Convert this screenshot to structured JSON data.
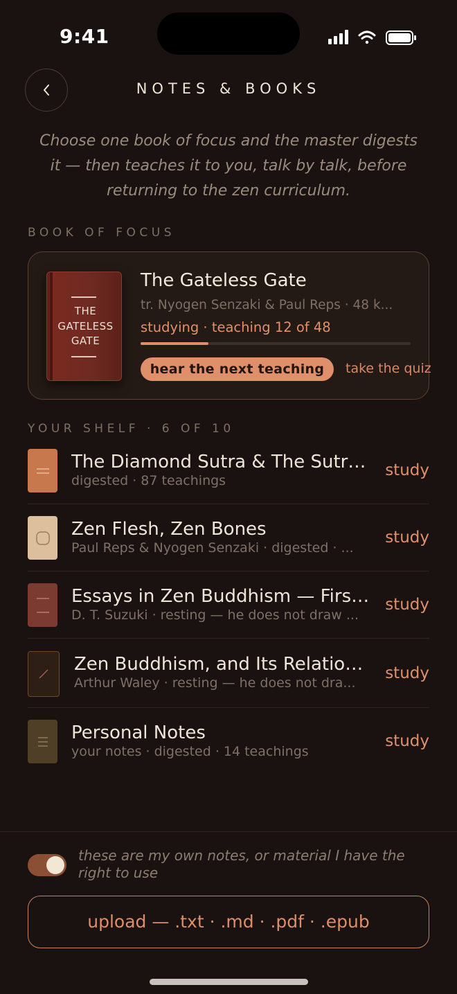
{
  "status_bar": {
    "time": "9:41",
    "icons": [
      "signal-icon",
      "wifi-icon",
      "battery-icon"
    ]
  },
  "header": {
    "back_icon": "chevron-left-icon",
    "title": "NOTES & BOOKS"
  },
  "intro": "Choose one book of focus and the master digests it — then teaches it to you, talk by talk, before returning to the zen curriculum.",
  "focus_section": {
    "label": "BOOK OF FOCUS",
    "book": {
      "cover_text": "THE GATELESS GATE",
      "title": "The Gateless Gate",
      "author": "tr. Nyogen Senzaki & Paul Reps · 48 k...",
      "status": "studying · teaching 12 of 48",
      "progress": 0.25,
      "primary_action": "hear the next teaching",
      "secondary_action": "take the quiz"
    }
  },
  "shelf": {
    "label": "YOUR SHELF · 6 OF 10",
    "items": [
      {
        "title": "The Diamond Sutra & The Sutra...",
        "meta": "digested · 87 teachings",
        "action": "study",
        "cover_color": "#c7794d",
        "cover_icon": "lines-icon"
      },
      {
        "title": "Zen Flesh, Zen Bones",
        "meta": "Paul Reps & Nyogen Senzaki · digested · ...",
        "action": "study",
        "cover_color": "#dcbf9c",
        "cover_icon": "circle-icon"
      },
      {
        "title": "Essays in Zen Buddhism — First...",
        "meta": "D. T. Suzuki · resting — he does not draw ...",
        "action": "study",
        "cover_color": "#7c3b31",
        "cover_icon": "lines-icon"
      },
      {
        "title": "Zen Buddhism, and Its Relation...",
        "meta": "Arthur Waley · resting — he does not dra...",
        "action": "study",
        "cover_color": "#2d1e16",
        "cover_icon": "slash-icon"
      },
      {
        "title": "Personal Notes",
        "meta": "your notes · digested · 14 teachings",
        "action": "study",
        "cover_color": "#4e3f26",
        "cover_icon": "lines-icon"
      }
    ]
  },
  "footer": {
    "rights_toggle_on": true,
    "rights_text": "these are my own notes, or material I have the right to use",
    "upload_label": "upload — .txt · .md · .pdf · .epub"
  },
  "colors": {
    "background": "#1a1210",
    "accent": "#df8f69",
    "muted": "#7f7066"
  }
}
